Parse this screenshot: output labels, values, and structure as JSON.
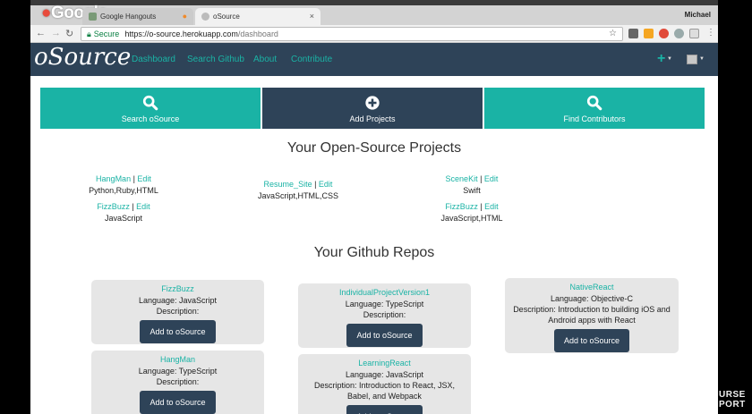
{
  "browser": {
    "logo": "Google",
    "tabs": [
      {
        "title": "Google Hangouts"
      },
      {
        "title": "oSource"
      }
    ],
    "user": "Michael",
    "address": {
      "secure_label": "Secure",
      "host": "https://o-source.herokuapp.com",
      "path": "/dashboard"
    }
  },
  "app": {
    "brand": "oSource",
    "nav": [
      "Dashboard",
      "Search Github",
      "About",
      "Contribute"
    ],
    "plus": "+"
  },
  "actions": [
    {
      "label": "Search oSource",
      "icon": "search-icon"
    },
    {
      "label": "Add Projects",
      "icon": "plus-circle-icon"
    },
    {
      "label": "Find Contributors",
      "icon": "search-icon"
    }
  ],
  "projects_section": {
    "title": "Your Open-Source Projects",
    "edit_label": "Edit",
    "items": [
      {
        "name": "HangMan",
        "langs": "Python,Ruby,HTML"
      },
      {
        "name": "Resume_Site",
        "langs": "JavaScript,HTML,CSS"
      },
      {
        "name": "SceneKit",
        "langs": "Swift"
      },
      {
        "name": "FizzBuzz",
        "langs": "JavaScript"
      },
      {
        "name": "FizzBuzz",
        "langs": "JavaScript,HTML"
      }
    ]
  },
  "repos_section": {
    "title": "Your Github Repos",
    "add_label": "Add to oSource",
    "repos": [
      {
        "name": "FizzBuzz",
        "language": "Language: JavaScript",
        "description": "Description:"
      },
      {
        "name": "IndividualProjectVersion1",
        "language": "Language: TypeScript",
        "description": "Description:"
      },
      {
        "name": "NativeReact",
        "language": "Language: Objective-C",
        "description": "Description: Introduction to building iOS and Android apps with React"
      },
      {
        "name": "HangMan",
        "language": "Language: TypeScript",
        "description": "Description:"
      },
      {
        "name": "LearningReact",
        "language": "Language: JavaScript",
        "description": "Description: Introduction to React, JSX, Babel, and Webpack"
      }
    ]
  },
  "watermark": [
    "URSE",
    "PORT"
  ]
}
